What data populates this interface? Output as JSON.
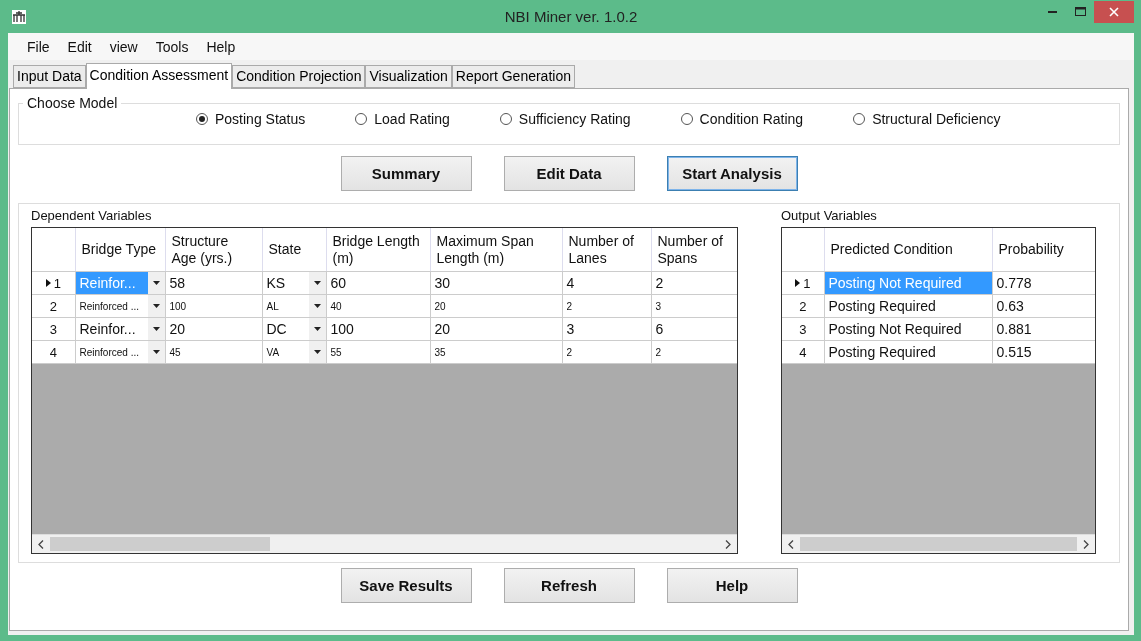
{
  "window": {
    "title": "NBI Miner ver. 1.0.2"
  },
  "menu": [
    "File",
    "Edit",
    "view",
    "Tools",
    "Help"
  ],
  "tabs": [
    {
      "label": "Input Data",
      "selected": false
    },
    {
      "label": "Condition Assessment",
      "selected": true
    },
    {
      "label": "Condition Projection",
      "selected": false
    },
    {
      "label": "Visualization",
      "selected": false
    },
    {
      "label": "Report Generation",
      "selected": false
    }
  ],
  "model_group": {
    "title": "Choose Model",
    "options": [
      {
        "label": "Posting Status",
        "selected": true
      },
      {
        "label": "Load Rating",
        "selected": false
      },
      {
        "label": "Sufficiency Rating",
        "selected": false
      },
      {
        "label": "Condition Rating",
        "selected": false
      },
      {
        "label": "Structural Deficiency",
        "selected": false
      }
    ]
  },
  "actions": [
    {
      "label": "Summary",
      "focused": false
    },
    {
      "label": "Edit Data",
      "focused": false
    },
    {
      "label": "Start Analysis",
      "focused": true
    }
  ],
  "dependent": {
    "title": "Dependent Variables",
    "columns": [
      {
        "label": "Bridge Type",
        "kind": "combo"
      },
      {
        "label": "Structure Age (yrs.)",
        "kind": "text"
      },
      {
        "label": "State",
        "kind": "combo"
      },
      {
        "label": "Bridge Length (m)",
        "kind": "text"
      },
      {
        "label": "Maximum Span Length (m)",
        "kind": "text"
      },
      {
        "label": "Number of Lanes",
        "kind": "text"
      },
      {
        "label": "Number of Spans",
        "kind": "text"
      }
    ],
    "rows": [
      {
        "number": "1",
        "current": true,
        "selected": true,
        "small": false,
        "cells": [
          "Reinfor...",
          "58",
          "KS",
          "60",
          "30",
          "4",
          "2"
        ]
      },
      {
        "number": "2",
        "current": false,
        "selected": false,
        "small": true,
        "cells": [
          "Reinforced ...",
          "100",
          "AL",
          "40",
          "20",
          "2",
          "3"
        ]
      },
      {
        "number": "3",
        "current": false,
        "selected": false,
        "small": false,
        "cells": [
          "Reinfor...",
          "20",
          "DC",
          "100",
          "20",
          "3",
          "6"
        ]
      },
      {
        "number": "4",
        "current": false,
        "selected": false,
        "small": true,
        "cells": [
          "Reinforced ...",
          "45",
          "VA",
          "55",
          "35",
          "2",
          "2"
        ]
      }
    ]
  },
  "output": {
    "title": "Output Variables",
    "columns": [
      {
        "label": "Predicted Condition",
        "kind": "text"
      },
      {
        "label": "Probability",
        "kind": "text"
      }
    ],
    "rows": [
      {
        "number": "1",
        "current": true,
        "selected": true,
        "cells": [
          "Posting Not Required",
          "0.778"
        ]
      },
      {
        "number": "2",
        "current": false,
        "selected": false,
        "cells": [
          "Posting Required",
          "0.63"
        ]
      },
      {
        "number": "3",
        "current": false,
        "selected": false,
        "cells": [
          "Posting Not Required",
          "0.881"
        ]
      },
      {
        "number": "4",
        "current": false,
        "selected": false,
        "cells": [
          "Posting Required",
          "0.515"
        ]
      }
    ]
  },
  "bottom_buttons": [
    "Save Results",
    "Refresh",
    "Help"
  ]
}
